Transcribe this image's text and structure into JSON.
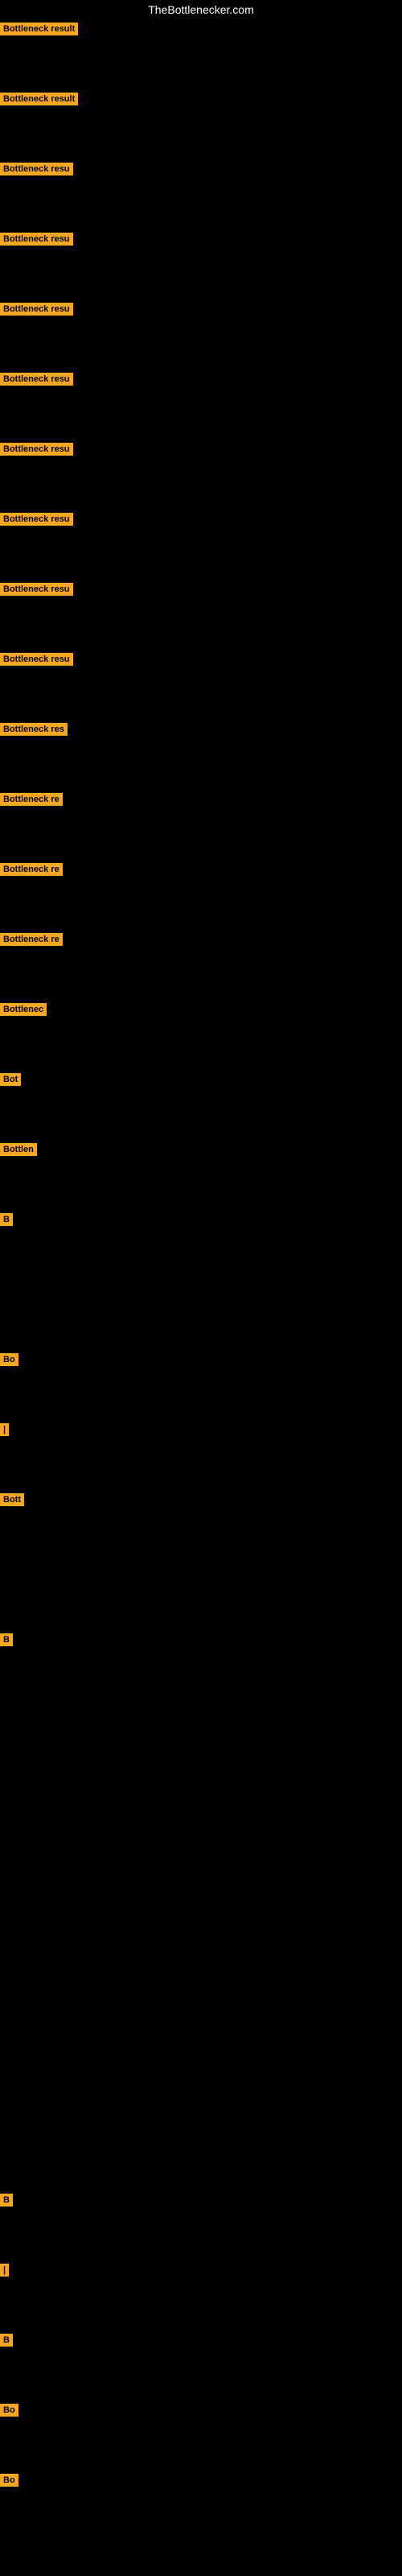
{
  "site": {
    "title": "TheBottlenecker.com"
  },
  "items": [
    {
      "id": 1,
      "label": "Bottleneck result",
      "badge_width": 100
    },
    {
      "id": 2,
      "label": "Bottleneck result",
      "badge_width": 100
    },
    {
      "id": 3,
      "label": "Bottleneck resu",
      "badge_width": 95
    },
    {
      "id": 4,
      "label": "Bottleneck resu",
      "badge_width": 95
    },
    {
      "id": 5,
      "label": "Bottleneck resu",
      "badge_width": 95
    },
    {
      "id": 6,
      "label": "Bottleneck resu",
      "badge_width": 95
    },
    {
      "id": 7,
      "label": "Bottleneck resu",
      "badge_width": 95
    },
    {
      "id": 8,
      "label": "Bottleneck resu",
      "badge_width": 90
    },
    {
      "id": 9,
      "label": "Bottleneck resu",
      "badge_width": 90
    },
    {
      "id": 10,
      "label": "Bottleneck resu",
      "badge_width": 90
    },
    {
      "id": 11,
      "label": "Bottleneck res",
      "badge_width": 85
    },
    {
      "id": 12,
      "label": "Bottleneck re",
      "badge_width": 80
    },
    {
      "id": 13,
      "label": "Bottleneck re",
      "badge_width": 80
    },
    {
      "id": 14,
      "label": "Bottleneck re",
      "badge_width": 78
    },
    {
      "id": 15,
      "label": "Bottlenec",
      "badge_width": 65
    },
    {
      "id": 16,
      "label": "Bot",
      "badge_width": 30
    },
    {
      "id": 17,
      "label": "Bottlen",
      "badge_width": 55
    },
    {
      "id": 18,
      "label": "B",
      "badge_width": 12
    },
    {
      "id": 19,
      "label": "",
      "badge_width": 0
    },
    {
      "id": 20,
      "label": "Bo",
      "badge_width": 20
    },
    {
      "id": 21,
      "label": "|",
      "badge_width": 6
    },
    {
      "id": 22,
      "label": "Bott",
      "badge_width": 32
    },
    {
      "id": 23,
      "label": "",
      "badge_width": 0
    },
    {
      "id": 24,
      "label": "B",
      "badge_width": 12
    },
    {
      "id": 25,
      "label": "",
      "badge_width": 0
    },
    {
      "id": 26,
      "label": "",
      "badge_width": 0
    },
    {
      "id": 27,
      "label": "",
      "badge_width": 0
    },
    {
      "id": 28,
      "label": "",
      "badge_width": 0
    },
    {
      "id": 29,
      "label": "",
      "badge_width": 0
    },
    {
      "id": 30,
      "label": "",
      "badge_width": 0
    },
    {
      "id": 31,
      "label": "",
      "badge_width": 0
    },
    {
      "id": 32,
      "label": "B",
      "badge_width": 10
    },
    {
      "id": 33,
      "label": "|",
      "badge_width": 6
    },
    {
      "id": 34,
      "label": "B",
      "badge_width": 12
    },
    {
      "id": 35,
      "label": "Bo",
      "badge_width": 20
    },
    {
      "id": 36,
      "label": "Bo",
      "badge_width": 22
    }
  ]
}
